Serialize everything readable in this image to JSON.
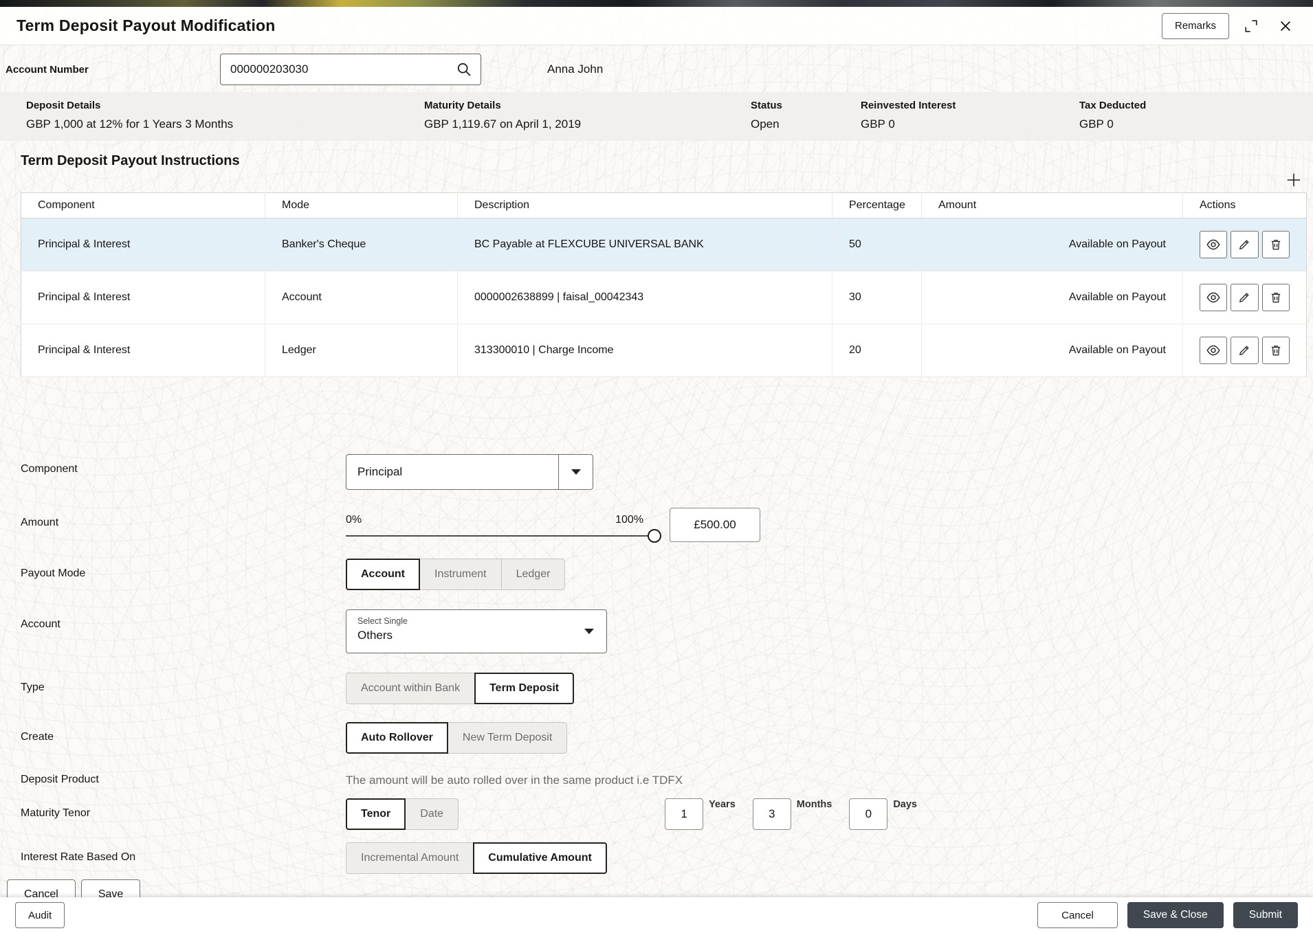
{
  "header": {
    "title": "Term Deposit Payout Modification",
    "remarks_label": "Remarks"
  },
  "account": {
    "label": "Account Number",
    "value": "000000203030",
    "holder": "Anna John"
  },
  "summary": {
    "items": [
      {
        "label": "Deposit Details",
        "value": "GBP 1,000 at 12% for 1 Years 3 Months"
      },
      {
        "label": "Maturity Details",
        "value": "GBP 1,119.67 on April 1, 2019"
      },
      {
        "label": "Status",
        "value": "Open"
      },
      {
        "label": "Reinvested Interest",
        "value": "GBP 0"
      },
      {
        "label": "Tax Deducted",
        "value": "GBP 0"
      }
    ]
  },
  "section": {
    "title": "Term Deposit Payout Instructions"
  },
  "table": {
    "headers": [
      "Component",
      "Mode",
      "Description",
      "Percentage",
      "Amount",
      "Actions"
    ],
    "rows": [
      {
        "component": "Principal & Interest",
        "mode": "Banker's Cheque",
        "description": "BC Payable at FLEXCUBE UNIVERSAL BANK",
        "percentage": "50",
        "amount": "Available on Payout",
        "selected": true
      },
      {
        "component": "Principal & Interest",
        "mode": "Account",
        "description": "0000002638899 | faisal_00042343",
        "percentage": "30",
        "amount": "Available on Payout",
        "selected": false
      },
      {
        "component": "Principal & Interest",
        "mode": "Ledger",
        "description": "313300010 | Charge Income",
        "percentage": "20",
        "amount": "Available on Payout",
        "selected": false
      }
    ]
  },
  "form": {
    "component": {
      "label": "Component",
      "value": "Principal"
    },
    "amount": {
      "label": "Amount",
      "min_label": "0%",
      "max_label": "100%",
      "value": "£500.00",
      "slider_position": "100%"
    },
    "payout_mode": {
      "label": "Payout Mode",
      "options": [
        "Account",
        "Instrument",
        "Ledger"
      ],
      "selected": "Account"
    },
    "account": {
      "label": "Account",
      "sub_label": "Select Single",
      "value": "Others"
    },
    "type": {
      "label": "Type",
      "options": [
        "Account within Bank",
        "Term Deposit"
      ],
      "selected": "Term Deposit"
    },
    "create": {
      "label": "Create",
      "options": [
        "Auto Rollover",
        "New Term Deposit"
      ],
      "selected": "Auto Rollover"
    },
    "deposit_product": {
      "label": "Deposit Product",
      "note": "The amount will be auto rolled over in the same product i.e TDFX"
    },
    "maturity_tenor": {
      "label": "Maturity Tenor",
      "options": [
        "Tenor",
        "Date"
      ],
      "selected": "Tenor",
      "years": {
        "value": "1",
        "label": "Years"
      },
      "months": {
        "value": "3",
        "label": "Months"
      },
      "days": {
        "value": "0",
        "label": "Days"
      }
    },
    "interest_rate": {
      "label": "Interest Rate Based On",
      "options": [
        "Incremental Amount",
        "Cumulative Amount"
      ],
      "selected": "Cumulative Amount"
    },
    "cancel_label": "Cancel",
    "save_label": "Save"
  },
  "footer": {
    "audit_label": "Audit",
    "cancel_label": "Cancel",
    "save_close_label": "Save & Close",
    "submit_label": "Submit"
  },
  "icons": {
    "search-icon": "⌕",
    "expand-icon": "⛶",
    "close-icon": "✕",
    "add-icon": "+",
    "view-icon": "eye",
    "edit-icon": "✎",
    "delete-icon": "trash",
    "dropdown-arrow-icon": "▼"
  },
  "colors": {
    "row_highlight": "#e4f0f7",
    "dark_button": "#40474e",
    "text": "#161513",
    "muted_text": "#6b6a66",
    "summary_strip": "#f1efeb"
  }
}
